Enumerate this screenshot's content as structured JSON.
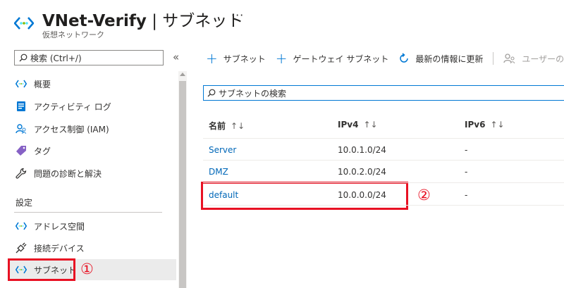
{
  "header": {
    "resource_name": "VNet-Verify",
    "separator": " | ",
    "page_name": "サブネット",
    "more": "···",
    "resource_type": "仮想ネットワーク"
  },
  "sidebar": {
    "search_placeholder": "検索 (Ctrl+/)",
    "collapse": "«",
    "items": [
      {
        "label": "概要",
        "icon": "vnet-icon"
      },
      {
        "label": "アクティビティ ログ",
        "icon": "activity-log-icon"
      },
      {
        "label": "アクセス制御 (IAM)",
        "icon": "iam-icon"
      },
      {
        "label": "タグ",
        "icon": "tag-icon"
      },
      {
        "label": "問題の診断と解決",
        "icon": "wrench-icon"
      }
    ],
    "section_label": "設定",
    "settings_items": [
      {
        "label": "アドレス空間",
        "icon": "vnet-icon"
      },
      {
        "label": "接続デバイス",
        "icon": "plug-icon"
      },
      {
        "label": "サブネット",
        "icon": "vnet-icon",
        "selected": true
      }
    ]
  },
  "annotations": {
    "mark1": "①",
    "mark2": "②",
    "color": "#e81123"
  },
  "toolbar": {
    "add_subnet": "サブネット",
    "add_gateway_subnet": "ゲートウェイ サブネット",
    "refresh": "最新の情報に更新",
    "manage_users": "ユーザーの管理"
  },
  "filter": {
    "placeholder": "サブネットの検索"
  },
  "table": {
    "columns": [
      "名前",
      "IPv4",
      "IPv6"
    ],
    "sort_icon": "↑↓",
    "rows": [
      {
        "name": "Server",
        "ipv4": "10.0.1.0/24",
        "ipv6": "-"
      },
      {
        "name": "DMZ",
        "ipv4": "10.0.2.0/24",
        "ipv6": "-"
      },
      {
        "name": "default",
        "ipv4": "10.0.0.0/24",
        "ipv6": "-"
      }
    ]
  },
  "colors": {
    "accent": "#0078d4",
    "link": "#0067b8",
    "selected_bg": "#ebebeb"
  }
}
